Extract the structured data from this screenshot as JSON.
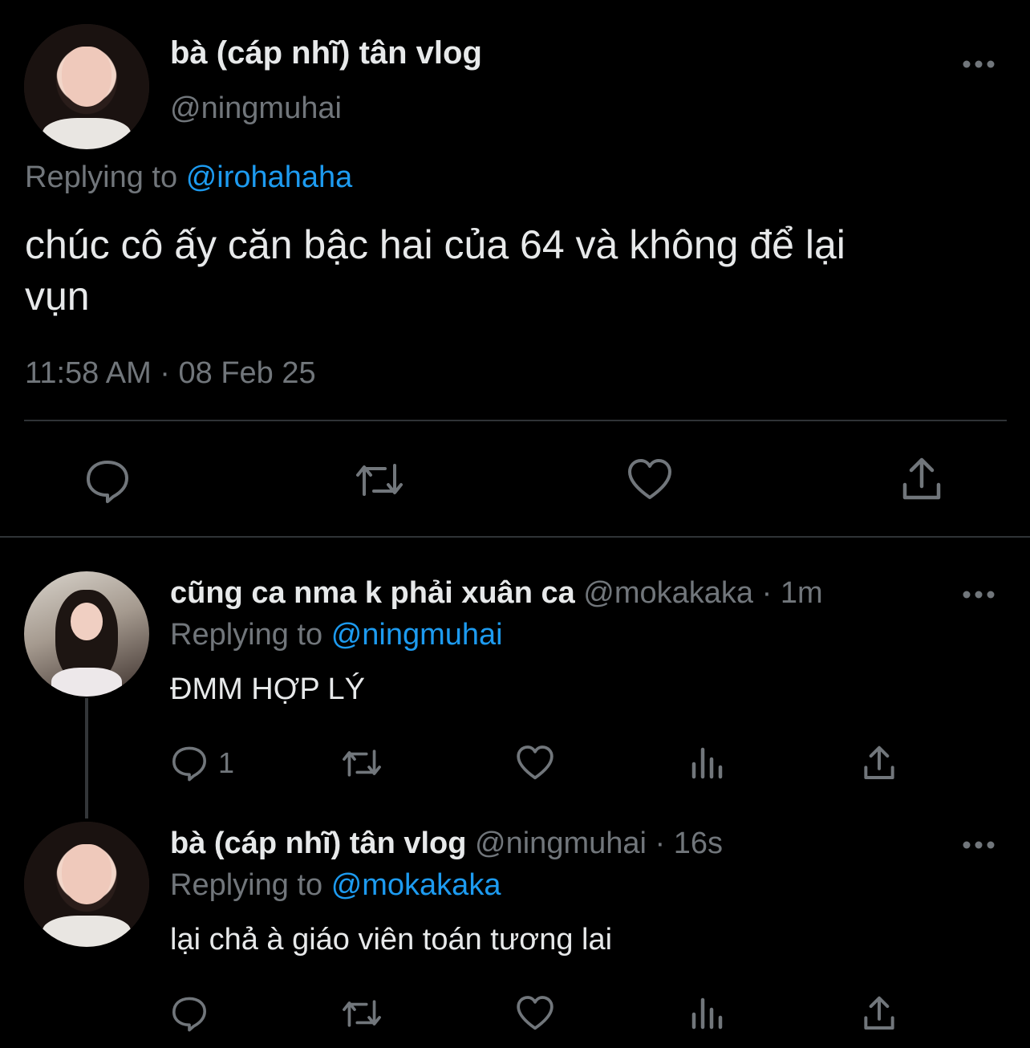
{
  "main_tweet": {
    "display_name": "bà (cáp nhĩ) tân vlog",
    "handle": "@ningmuhai",
    "replying_prefix": "Replying to",
    "replying_handle": "@irohahaha",
    "text_line1": "chúc cô ấy căn bậc hai của 64 và không để lại",
    "text_line2": "vụn",
    "timestamp": "11:58 AM · 08 Feb 25",
    "actions": [
      "reply-icon",
      "retweet-icon",
      "like-icon",
      "share-icon"
    ]
  },
  "replies": [
    {
      "display_name": "cũng ca nma k phải xuân ca",
      "meta": "@mokakaka · 1m",
      "replying_prefix": "Replying to",
      "replying_handle": "@ningmuhai",
      "text": "ĐMM HỢP LÝ",
      "reply_count": "1",
      "actions": [
        "reply-icon",
        "retweet-icon",
        "like-icon",
        "analytics-icon",
        "share-icon"
      ]
    },
    {
      "display_name": "bà (cáp nhĩ) tân vlog",
      "meta": "@ningmuhai · 16s",
      "replying_prefix": "Replying to",
      "replying_handle": "@mokakaka",
      "text": "lại chả à giáo viên toán tương lai",
      "actions": [
        "reply-icon",
        "retweet-icon",
        "like-icon",
        "analytics-icon",
        "share-icon"
      ]
    }
  ],
  "colors": {
    "background": "#000000",
    "text": "#e7e9ea",
    "secondary": "#71767b",
    "link": "#1d9bf0"
  }
}
